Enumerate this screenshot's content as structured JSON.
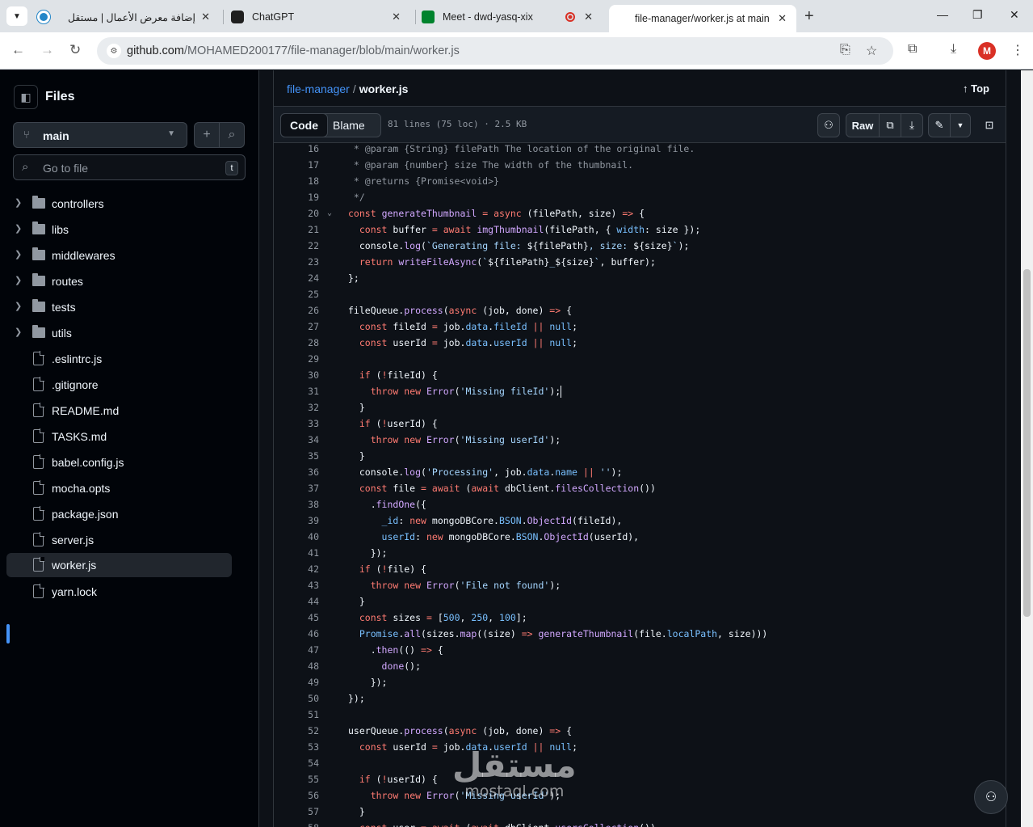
{
  "browser": {
    "tabs": [
      {
        "title": "إضافة معرض الأعمال | مستقل",
        "fav_color": "#2386c8"
      },
      {
        "title": "ChatGPT",
        "fav_color": "#1f1f1f"
      },
      {
        "title": "Meet - dwd-yasq-xix",
        "fav_color": "#00832d"
      },
      {
        "title": "file-manager/worker.js at main ·",
        "fav_color": "#1f1f1f"
      }
    ],
    "url_host": "github.com",
    "url_path": "/MOHAMED200177/file-manager/blob/main/worker.js",
    "avatar_letter": "M"
  },
  "sidebar": {
    "title": "Files",
    "branch": "main",
    "search_placeholder": "Go to file",
    "search_shortcut": "t",
    "folders": [
      "controllers",
      "libs",
      "middlewares",
      "routes",
      "tests",
      "utils"
    ],
    "files": [
      ".eslintrc.js",
      ".gitignore",
      "README.md",
      "TASKS.md",
      "babel.config.js",
      "mocha.opts",
      "package.json",
      "server.js",
      "worker.js",
      "yarn.lock"
    ],
    "selected": "worker.js"
  },
  "file": {
    "repo": "file-manager",
    "separator": "/",
    "name": "worker.js",
    "top_label": "Top",
    "tab_code": "Code",
    "tab_blame": "Blame",
    "meta": "81 lines (75 loc) · 2.5 KB",
    "raw_label": "Raw"
  },
  "code_lines": [
    {
      "n": "16",
      "html": "<span class='c'> * @param {String} filePath The location of the original file.</span>"
    },
    {
      "n": "17",
      "html": "<span class='c'> * @param {number} size The width of the thumbnail.</span>"
    },
    {
      "n": "18",
      "html": "<span class='c'> * @returns {Promise&lt;void&gt;}</span>"
    },
    {
      "n": "19",
      "html": "<span class='c'> */</span>"
    },
    {
      "n": "20",
      "fold": true,
      "html": "<span class='k'>const</span> <span class='f'>generateThumbnail</span> <span class='o'>=</span> <span class='k'>async</span> (filePath, size) <span class='o'>=&gt;</span> {"
    },
    {
      "n": "21",
      "html": "  <span class='k'>const</span> buffer <span class='o'>=</span> <span class='k'>await</span> <span class='f'>imgThumbnail</span>(filePath, { <span class='p'>width</span>: size });"
    },
    {
      "n": "22",
      "html": "  console.<span class='f'>log</span>(<span class='s'>`Generating file: </span>${filePath}<span class='s'>, size: </span>${size}<span class='s'>`</span>);"
    },
    {
      "n": "23",
      "html": "  <span class='k'>return</span> <span class='f'>writeFileAsync</span>(<span class='s'>`</span>${filePath}<span class='s'>_</span>${size}<span class='s'>`</span>, buffer);"
    },
    {
      "n": "24",
      "html": "};"
    },
    {
      "n": "25",
      "html": ""
    },
    {
      "n": "26",
      "html": "fileQueue.<span class='f'>process</span>(<span class='k'>async</span> (job, done) <span class='o'>=&gt;</span> {"
    },
    {
      "n": "27",
      "html": "  <span class='k'>const</span> fileId <span class='o'>=</span> job.<span class='p'>data</span>.<span class='p'>fileId</span> <span class='o'>||</span> <span class='p'>null</span>;"
    },
    {
      "n": "28",
      "html": "  <span class='k'>const</span> userId <span class='o'>=</span> job.<span class='p'>data</span>.<span class='p'>userId</span> <span class='o'>||</span> <span class='p'>null</span>;"
    },
    {
      "n": "29",
      "html": ""
    },
    {
      "n": "30",
      "html": "  <span class='k'>if</span> (<span class='o'>!</span>fileId) {"
    },
    {
      "n": "31",
      "cursor": true,
      "html": "    <span class='k'>throw</span> <span class='k'>new</span> <span class='f'>Error</span>(<span class='s'>'Missing fileId'</span>);"
    },
    {
      "n": "32",
      "html": "  }"
    },
    {
      "n": "33",
      "html": "  <span class='k'>if</span> (<span class='o'>!</span>userId) {"
    },
    {
      "n": "34",
      "html": "    <span class='k'>throw</span> <span class='k'>new</span> <span class='f'>Error</span>(<span class='s'>'Missing userId'</span>);"
    },
    {
      "n": "35",
      "html": "  }"
    },
    {
      "n": "36",
      "html": "  console.<span class='f'>log</span>(<span class='s'>'Processing'</span>, job.<span class='p'>data</span>.<span class='p'>name</span> <span class='o'>||</span> <span class='s'>''</span>);"
    },
    {
      "n": "37",
      "html": "  <span class='k'>const</span> file <span class='o'>=</span> <span class='k'>await</span> (<span class='k'>await</span> dbClient.<span class='f'>filesCollection</span>())"
    },
    {
      "n": "38",
      "html": "    .<span class='f'>findOne</span>({"
    },
    {
      "n": "39",
      "html": "      <span class='p'>_id</span>: <span class='k'>new</span> mongoDBCore.<span class='p'>BSON</span>.<span class='f'>ObjectId</span>(fileId),"
    },
    {
      "n": "40",
      "html": "      <span class='p'>userId</span>: <span class='k'>new</span> mongoDBCore.<span class='p'>BSON</span>.<span class='f'>ObjectId</span>(userId),"
    },
    {
      "n": "41",
      "html": "    });"
    },
    {
      "n": "42",
      "html": "  <span class='k'>if</span> (<span class='o'>!</span>file) {"
    },
    {
      "n": "43",
      "html": "    <span class='k'>throw</span> <span class='k'>new</span> <span class='f'>Error</span>(<span class='s'>'File not found'</span>);"
    },
    {
      "n": "44",
      "html": "  }"
    },
    {
      "n": "45",
      "html": "  <span class='k'>const</span> sizes <span class='o'>=</span> [<span class='p'>500</span>, <span class='p'>250</span>, <span class='p'>100</span>];"
    },
    {
      "n": "46",
      "html": "  <span class='p'>Promise</span>.<span class='f'>all</span>(sizes.<span class='f'>map</span>((size) <span class='o'>=&gt;</span> <span class='f'>generateThumbnail</span>(file.<span class='p'>localPath</span>, size)))"
    },
    {
      "n": "47",
      "html": "    .<span class='f'>then</span>(() <span class='o'>=&gt;</span> {"
    },
    {
      "n": "48",
      "html": "      <span class='f'>done</span>();"
    },
    {
      "n": "49",
      "html": "    });"
    },
    {
      "n": "50",
      "html": "});"
    },
    {
      "n": "51",
      "html": ""
    },
    {
      "n": "52",
      "html": "userQueue.<span class='f'>process</span>(<span class='k'>async</span> (job, done) <span class='o'>=&gt;</span> {"
    },
    {
      "n": "53",
      "html": "  <span class='k'>const</span> userId <span class='o'>=</span> job.<span class='p'>data</span>.<span class='p'>userId</span> <span class='o'>||</span> <span class='p'>null</span>;"
    },
    {
      "n": "54",
      "html": ""
    },
    {
      "n": "55",
      "html": "  <span class='k'>if</span> (<span class='o'>!</span>userId) {"
    },
    {
      "n": "56",
      "html": "    <span class='k'>throw</span> <span class='k'>new</span> <span class='f'>Error</span>(<span class='s'>'Missing userId'</span>);"
    },
    {
      "n": "57",
      "html": "  }"
    },
    {
      "n": "58",
      "html": "  <span class='k'>const</span> user <span class='o'>=</span> <span class='k'>await</span> (<span class='k'>await</span> dbClient.<span class='f'>usersCollection</span>())"
    }
  ],
  "watermark": {
    "arabic": "مستقل",
    "latin": "mostaql.com"
  },
  "colors": {
    "accent": "#4493f8",
    "bg": "#0d1117",
    "keyword": "#ff7b72",
    "function": "#d2a8ff",
    "string": "#a5d6ff"
  }
}
